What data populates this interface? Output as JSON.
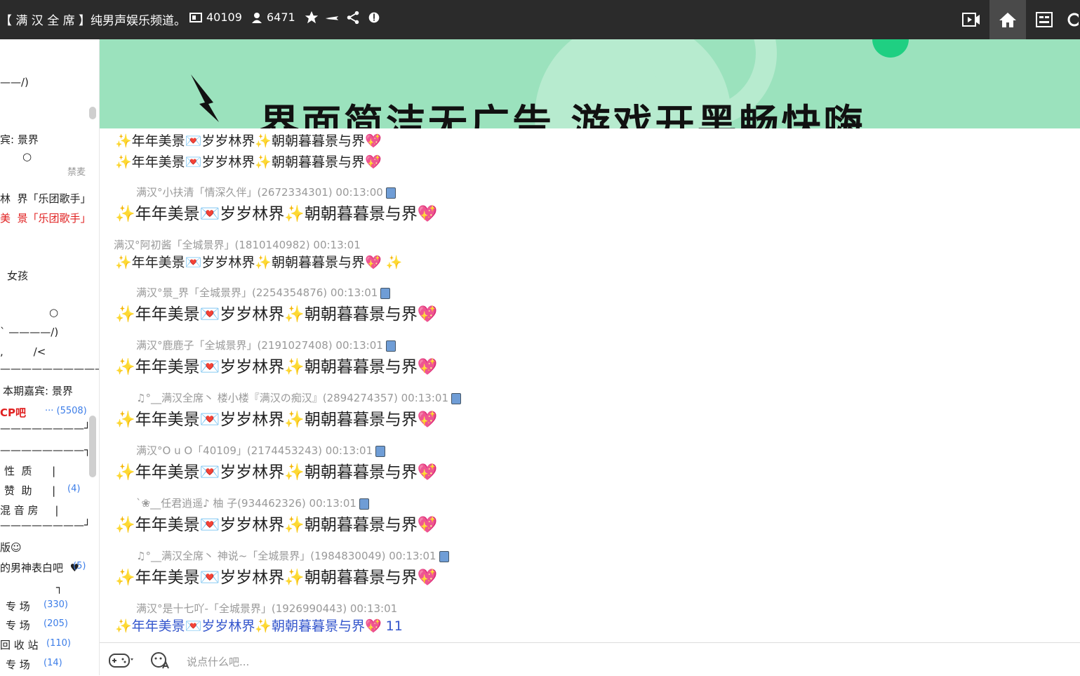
{
  "topbar": {
    "title": "【 满 汉 全 席 】纯男声娱乐频道。",
    "room_id": "40109",
    "users": "6471"
  },
  "sidebar": {
    "lines": [
      {
        "text": "——/)",
        "cls": ""
      },
      {
        "text": "宾: 景界",
        "cls": ""
      },
      {
        "text": "○",
        "cls": ""
      },
      {
        "text": "禁麦",
        "cls": "mute"
      },
      {
        "text": "林  界「乐团歌手」",
        "cls": ""
      },
      {
        "text": "美  景「乐团歌手」",
        "cls": "red"
      },
      {
        "text": "女孩",
        "cls": ""
      },
      {
        "text": "○",
        "cls": ""
      },
      {
        "text": "` ————/)",
        "cls": ""
      },
      {
        "text": ",         /<",
        "cls": ""
      },
      {
        "text": "——————————",
        "cls": ""
      },
      {
        "text": "本期嘉宾: 景界",
        "cls": ""
      },
      {
        "text": "CP吧",
        "cls": "red"
      },
      {
        "text": "··· (5508)",
        "cls": "blue"
      },
      {
        "text": "————————┘",
        "cls": ""
      },
      {
        "text": "————————┐",
        "cls": ""
      },
      {
        "text": "性  质      |",
        "cls": ""
      },
      {
        "text": "赞  助      |",
        "cls": ""
      },
      {
        "text": "(4)",
        "cls": "blue"
      },
      {
        "text": "混 音 房     |",
        "cls": ""
      },
      {
        "text": "————————┘",
        "cls": ""
      },
      {
        "text": "版☺",
        "cls": ""
      },
      {
        "text": "的男神表白吧  ♥",
        "cls": ""
      },
      {
        "text": "(5)",
        "cls": "blue"
      },
      {
        "text": "┐",
        "cls": ""
      },
      {
        "text": "专 场",
        "cls": ""
      },
      {
        "text": "(330)",
        "cls": "blue"
      },
      {
        "text": "专 场",
        "cls": ""
      },
      {
        "text": "(205)",
        "cls": "blue"
      },
      {
        "text": "回 收 站",
        "cls": ""
      },
      {
        "text": "(110)",
        "cls": "blue"
      },
      {
        "text": "专 场",
        "cls": ""
      },
      {
        "text": "(14)",
        "cls": "blue"
      }
    ]
  },
  "banner": {
    "text": "界面简洁无广告  游戏开黑畅快嗨"
  },
  "chat": {
    "message_text": "✨年年美景💌岁岁林界✨朝朝暮暮景与界💖",
    "message_text_extra": "✨年年美景💌岁岁林界✨朝朝暮暮景与界💖 ✨",
    "message_text_last": "✨年年美景💌岁岁林界✨朝朝暮暮景与界💖 11",
    "messages": [
      {
        "meta": "满汉°小扶清「情深久伴」(2672334301)  00:13:00"
      },
      {
        "meta": "满汉°阿初酱「全城景界」(1810140982)  00:13:01"
      },
      {
        "meta": "满汉°景_界「全城景界」(2254354876)  00:13:01"
      },
      {
        "meta": "满汉°鹿鹿子「全城景界」(2191027408)  00:13:01"
      },
      {
        "meta": "♫°__满汉全席丶 楼小楼『满汉の痴汉』(2894274357)  00:13:01"
      },
      {
        "meta": "满汉°O u O「40109」(2174453243)  00:13:01"
      },
      {
        "meta": "`❀__任君逍遥♪ 柚    子(934462326)  00:13:01"
      },
      {
        "meta": "♫°__满汉全席丶 神说~「全城景界」(1984830049)  00:13:01"
      },
      {
        "meta": "满汉°是十七吖-「全城景界」(1926990443)  00:13:01"
      }
    ]
  },
  "input": {
    "placeholder": "说点什么吧..."
  }
}
